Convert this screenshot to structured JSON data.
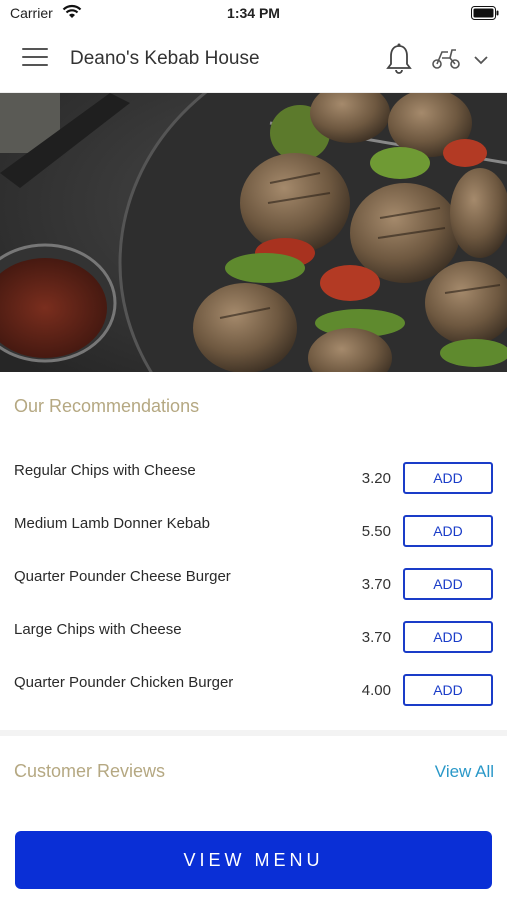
{
  "status_bar": {
    "carrier": "Carrier",
    "time": "1:34 PM"
  },
  "header": {
    "title": "Deano's Kebab House",
    "icons": [
      "menu-icon",
      "bell-icon",
      "scooter-icon",
      "chevron-down-icon"
    ]
  },
  "recommendations": {
    "title": "Our Recommendations",
    "add_label": "ADD",
    "items": [
      {
        "name": "Regular Chips with Cheese",
        "price": "3.20"
      },
      {
        "name": "Medium Lamb Donner Kebab",
        "price": "5.50"
      },
      {
        "name": "Quarter Pounder Cheese Burger",
        "price": "3.70"
      },
      {
        "name": "Large Chips with Cheese",
        "price": "3.70"
      },
      {
        "name": "Quarter Pounder Chicken Burger",
        "price": "4.00"
      }
    ]
  },
  "reviews": {
    "title": "Customer Reviews",
    "view_all": "View All"
  },
  "footer": {
    "view_menu": "VIEW MENU"
  },
  "colors": {
    "accent": "#0a2fd6",
    "heading": "#b5a882",
    "link": "#2a98c8"
  }
}
